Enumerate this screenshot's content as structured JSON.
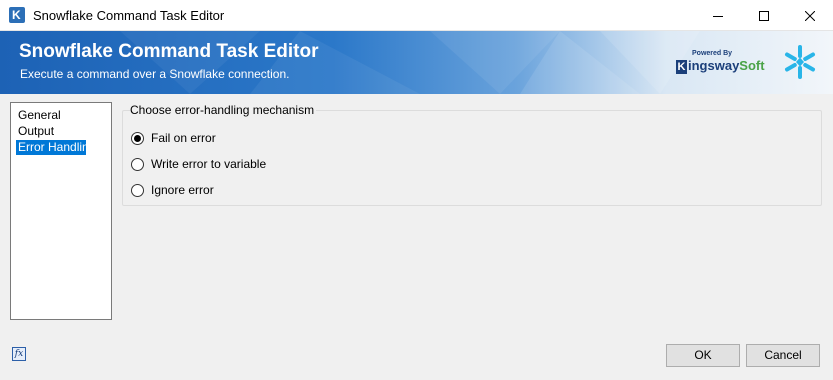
{
  "window": {
    "title": "Snowflake Command Task Editor"
  },
  "banner": {
    "title": "Snowflake Command Task Editor",
    "subtitle": "Execute a command over a Snowflake connection.",
    "logo_powered": "Powered By",
    "logo_name_a": "ingsway",
    "logo_name_b": "Soft"
  },
  "nav": {
    "items": [
      {
        "label": "General"
      },
      {
        "label": "Output"
      },
      {
        "label": "Error Handling"
      }
    ],
    "selected": "Error Handling"
  },
  "error_group": {
    "legend": "Choose error-handling mechanism",
    "options": [
      {
        "label": "Fail on error",
        "checked": true
      },
      {
        "label": "Write error to variable",
        "checked": false
      },
      {
        "label": "Ignore error",
        "checked": false
      }
    ]
  },
  "footer": {
    "fx_label": "fx",
    "ok_label": "OK",
    "cancel_label": "Cancel"
  },
  "colors": {
    "selection": "#0078d7",
    "banner_start": "#1d62b5",
    "snowflake": "#29b5e8"
  }
}
